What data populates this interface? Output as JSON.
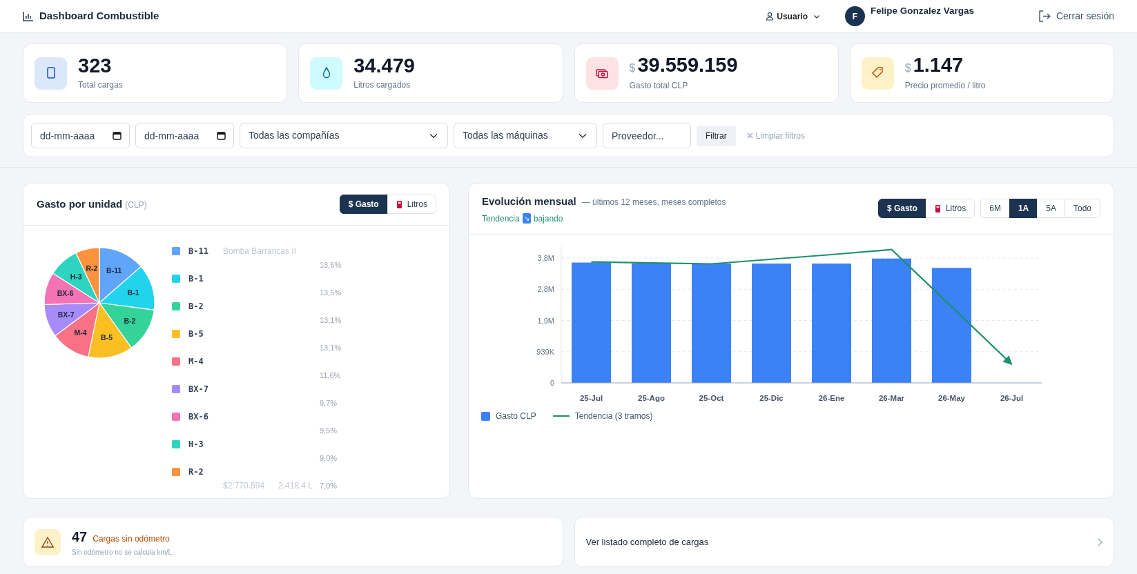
{
  "header": {
    "title": "Dashboard Combustible",
    "user_menu": "Usuario",
    "avatar": "F",
    "user_name": "Felipe Gonzalez Vargas",
    "logout": "Cerrar sesión"
  },
  "kpis": [
    {
      "kind": "count",
      "value": "323",
      "label": "Total cargas"
    },
    {
      "kind": "liters",
      "value": "34.479",
      "label": "Litros cargados"
    },
    {
      "kind": "money",
      "prefix": "$",
      "value": "39.559.159",
      "label": "Gasto total CLP"
    },
    {
      "kind": "price",
      "prefix": "$",
      "value": "1.147",
      "label": "Precio promedio / litro"
    }
  ],
  "filters": {
    "date_from": {
      "placeholder": "dd-mm-aaaa"
    },
    "date_to": {
      "placeholder": "dd-mm-aaaa"
    },
    "company": "Todas las compañías",
    "machine": "Todas las máquinas",
    "provider": {
      "placeholder": "Proveedor..."
    },
    "apply": "Filtrar",
    "clear": "Limpiar filtros"
  },
  "unit_panel": {
    "title": "Gasto por unidad",
    "unit": "(CLP)",
    "toggle": [
      {
        "label": "$ Gasto",
        "selected": true
      },
      {
        "label": "Litros",
        "selected": false
      }
    ],
    "chart_data": {
      "type": "pie",
      "categories": [
        "B-11",
        "B-1",
        "B-2",
        "B-5",
        "M-4",
        "BX-7",
        "BX-6",
        "H-3",
        "R-2"
      ],
      "values": [
        13.6,
        13.5,
        13.1,
        13.1,
        11.6,
        9.7,
        9.5,
        9.0,
        7.0
      ]
    },
    "legend": [
      {
        "code": "B-11",
        "color": "#60a5fa",
        "name": "Bomba Barrancas II",
        "percent": "13,6%"
      },
      {
        "code": "B-1",
        "color": "#22d3ee",
        "percent": "13,5%"
      },
      {
        "code": "B-2",
        "color": "#34d399",
        "percent": "13,1%"
      },
      {
        "code": "B-5",
        "color": "#fbbf24",
        "percent": "13,1%"
      },
      {
        "code": "M-4",
        "color": "#f87185",
        "percent": "11,6%"
      },
      {
        "code": "BX-7",
        "color": "#a78bfa",
        "percent": "9,7%"
      },
      {
        "code": "BX-6",
        "color": "#f472b6",
        "percent": "9,5%"
      },
      {
        "code": "H-3",
        "color": "#2dd4bf",
        "percent": "9,0%"
      },
      {
        "code": "R-2",
        "color": "#fb923c",
        "amount": "$2.770.594",
        "liters": "2.418,4 L",
        "percent": "7,0%"
      }
    ]
  },
  "monthly_panel": {
    "title": "Evolución mensual",
    "subtitle": "— últimos 12 meses, meses completos",
    "trend": {
      "label": "Tendencia",
      "arrow": "↘",
      "text": "bajando"
    },
    "metric_toggle": [
      {
        "label": "$ Gasto",
        "selected": true
      },
      {
        "label": "Litros",
        "selected": false
      }
    ],
    "range_toggle": [
      {
        "label": "6M",
        "selected": false
      },
      {
        "label": "1A",
        "selected": true
      },
      {
        "label": "5A",
        "selected": false
      },
      {
        "label": "Todo",
        "selected": false
      }
    ],
    "chart_data": {
      "type": "bar",
      "stacked": false,
      "grid": true,
      "ylim": [
        0,
        4100000
      ],
      "categories": [
        "25-Jul",
        "25-Ago",
        "25-Oct",
        "25-Dic",
        "26-Ene",
        "26-Mar",
        "26-May",
        "26-Jul"
      ],
      "yticks": [
        {
          "value": 0,
          "label": "0"
        },
        {
          "value": 939000,
          "label": "939K"
        },
        {
          "value": 1878000,
          "label": "1,9M"
        },
        {
          "value": 2817000,
          "label": "2,8M"
        },
        {
          "value": 3756000,
          "label": "3,8M"
        }
      ],
      "series": [
        {
          "name": "Gasto CLP",
          "type": "bar",
          "color": "#3b82f6",
          "values": [
            3620000,
            3590000,
            3590000,
            3590000,
            3590000,
            3740000,
            3460000,
            null
          ]
        },
        {
          "name": "Tendencia (3 tramos)",
          "type": "line",
          "color": "#1f8f6f",
          "values": [
            3640000,
            3610000,
            3580000,
            3720000,
            3860000,
            4010000,
            2290000,
            560000
          ]
        }
      ]
    }
  },
  "odometer": {
    "count": "47",
    "title": "Cargas sin odómetro",
    "note": "Sin odómetro no se calcula km/L."
  },
  "full_list_link": "Ver listado completo de cargas"
}
